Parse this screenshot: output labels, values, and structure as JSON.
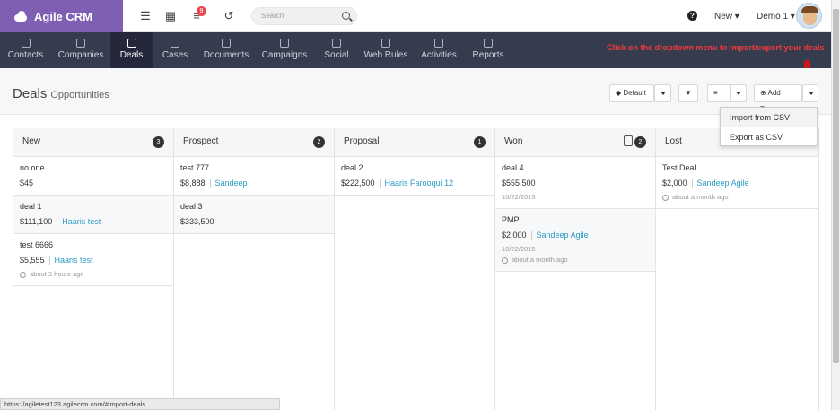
{
  "app": {
    "name": "Agile CRM"
  },
  "topbar": {
    "notif_count": "9",
    "search_placeholder": "Search",
    "new_label": "New",
    "user_label": "Demo 1"
  },
  "nav": {
    "items": [
      {
        "label": "Contacts"
      },
      {
        "label": "Companies"
      },
      {
        "label": "Deals"
      },
      {
        "label": "Cases"
      },
      {
        "label": "Documents"
      },
      {
        "label": "Campaigns"
      },
      {
        "label": "Social"
      },
      {
        "label": "Web Rules"
      },
      {
        "label": "Activities"
      },
      {
        "label": "Reports"
      }
    ],
    "active": "Deals",
    "annotation": "Click on the dropdown menu to import/export your deals"
  },
  "page": {
    "title": "Deals",
    "subtitle": "Opportunities",
    "default_button": "Default",
    "add_deal_button": "Add Deal"
  },
  "dropdown": {
    "items": [
      {
        "label": "Import from CSV"
      },
      {
        "label": "Export as CSV"
      }
    ]
  },
  "columns": [
    {
      "name": "New",
      "count": "3"
    },
    {
      "name": "Prospect",
      "count": "2"
    },
    {
      "name": "Proposal",
      "count": "1"
    },
    {
      "name": "Won",
      "count": "2"
    },
    {
      "name": "Lost",
      "count": ""
    }
  ],
  "deals": {
    "new": [
      {
        "name": "no one",
        "value": "$45"
      },
      {
        "name": "deal 1",
        "value": "$111,100",
        "contact": "Haaris test"
      },
      {
        "name": "test 6666",
        "value": "$5,555",
        "contact": "Haaris test",
        "meta": "about 2 hours ago"
      }
    ],
    "prospect": [
      {
        "name": "test 777",
        "value": "$8,888",
        "contact": "Sandeep"
      },
      {
        "name": "deal 3",
        "value": "$333,500"
      }
    ],
    "proposal": [
      {
        "name": "deal 2",
        "value": "$222,500",
        "contact": "Haaris Farooqui 12"
      }
    ],
    "won": [
      {
        "name": "deal 4",
        "value": "$555,500",
        "meta": "10/22/2015"
      },
      {
        "name": "PMP",
        "value": "$2,000",
        "contact": "Sandeep Agile",
        "meta": "10/22/2015",
        "meta2": "about a month ago"
      }
    ],
    "lost": [
      {
        "name": "Test Deal",
        "value": "$2,000",
        "contact": "Sandeep Agile",
        "meta": "about a month ago"
      }
    ]
  },
  "statusbar": {
    "url": "https://agiletest123.agilecrm.com/#import-deals"
  }
}
